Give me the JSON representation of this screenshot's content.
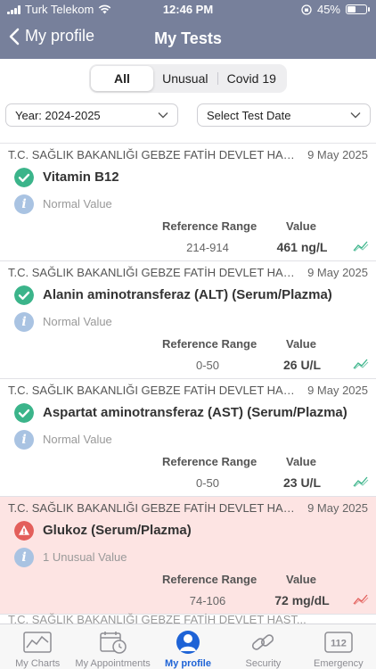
{
  "status_bar": {
    "carrier": "Turk Telekom",
    "time": "12:46 PM",
    "battery": "45%",
    "battery_level": 0.45
  },
  "nav": {
    "back_label": "My profile",
    "title": "My Tests"
  },
  "segments": [
    {
      "label": "All",
      "active": true
    },
    {
      "label": "Unusual",
      "active": false
    },
    {
      "label": "Covid 19",
      "active": false
    }
  ],
  "filters": {
    "year": "Year: 2024-2025",
    "test_date": "Select Test Date"
  },
  "columns": {
    "reference": "Reference Range",
    "value": "Value"
  },
  "tests": [
    {
      "hospital": "T.C. SAĞLIK BAKANLIĞI GEBZE FATİH DEVLET HAST...",
      "date": "9 May 2025",
      "name": "Vitamin B12",
      "note": "Normal Value",
      "reference": "214-914",
      "value": "461 ng/L",
      "status": "normal"
    },
    {
      "hospital": "T.C. SAĞLIK BAKANLIĞI GEBZE FATİH DEVLET HAST...",
      "date": "9 May 2025",
      "name": "Alanin aminotransferaz (ALT) (Serum/Plazma)",
      "note": "Normal Value",
      "reference": "0-50",
      "value": "26 U/L",
      "status": "normal"
    },
    {
      "hospital": "T.C. SAĞLIK BAKANLIĞI GEBZE FATİH DEVLET HAST...",
      "date": "9 May 2025",
      "name": "Aspartat aminotransferaz (AST) (Serum/Plazma)",
      "note": "Normal Value",
      "reference": "0-50",
      "value": "23 U/L",
      "status": "normal"
    },
    {
      "hospital": "T.C. SAĞLIK BAKANLIĞI GEBZE FATİH DEVLET HAST...",
      "date": "9 May 2025",
      "name": "Glukoz (Serum/Plazma)",
      "note": "1 Unusual Value",
      "reference": "74-106",
      "value": "72 mg/dL",
      "status": "unusual"
    }
  ],
  "peek_hospital": "T.C. SAĞLIK BAKANLIĞI GEBZE FATİH DEVLET HAST...",
  "tabbar": [
    {
      "label": "My Charts",
      "icon": "chart-icon",
      "active": false
    },
    {
      "label": "My Appointments",
      "icon": "calendar-clock-icon",
      "active": false
    },
    {
      "label": "My profile",
      "icon": "person-icon",
      "active": true
    },
    {
      "label": "Security",
      "icon": "link-icon",
      "active": false
    },
    {
      "label": "Emergency",
      "icon": "emergency-112-icon",
      "active": false
    }
  ],
  "colors": {
    "header": "#77809b",
    "normal": "#3bb48a",
    "unusual": "#e35f5b",
    "unusual_bg": "#fde4e3",
    "info": "#a9c3e2",
    "active_tab": "#1e63d6"
  },
  "emergency_badge": "112"
}
